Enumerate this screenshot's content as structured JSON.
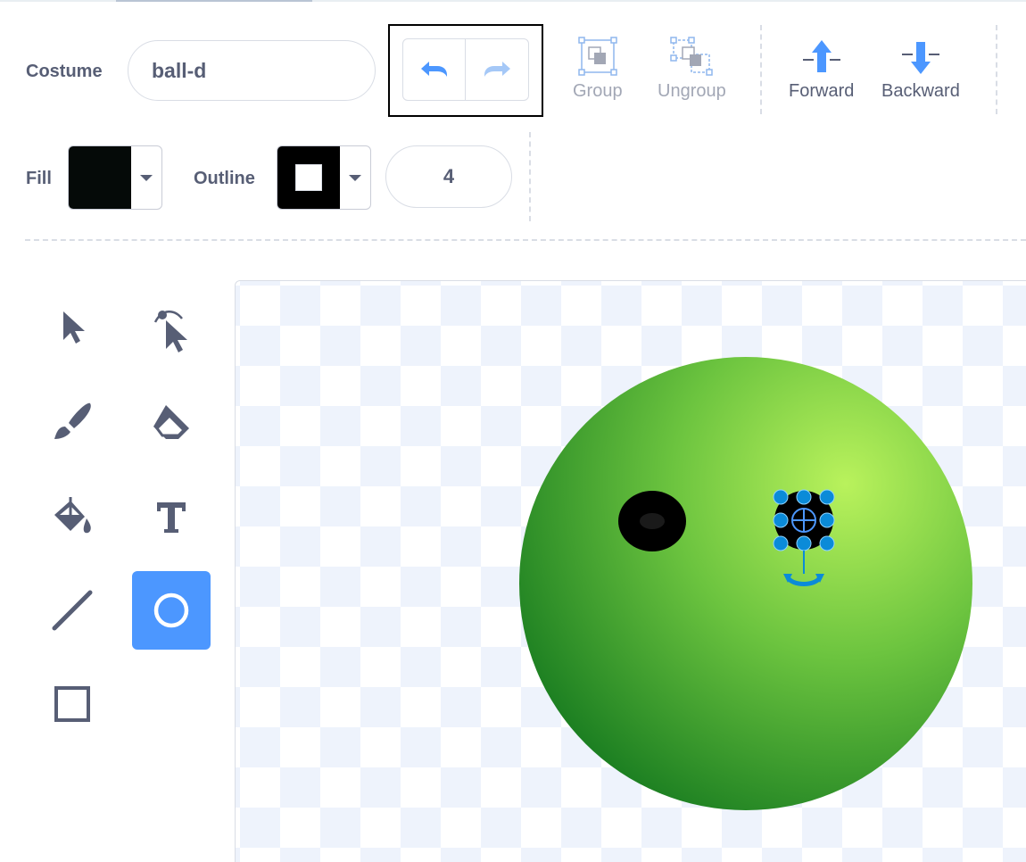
{
  "toolbar": {
    "costume_label": "Costume",
    "costume_name": "ball-d",
    "group_label": "Group",
    "ungroup_label": "Ungroup",
    "forward_label": "Forward",
    "backward_label": "Backward"
  },
  "style_bar": {
    "fill_label": "Fill",
    "outline_label": "Outline",
    "outline_width": "4",
    "fill_color": "#050a08",
    "outline_color": "#000000"
  },
  "tools": [
    {
      "name": "select-tool",
      "selected": false
    },
    {
      "name": "reshape-tool",
      "selected": false
    },
    {
      "name": "brush-tool",
      "selected": false
    },
    {
      "name": "eraser-tool",
      "selected": false
    },
    {
      "name": "fill-tool",
      "selected": false
    },
    {
      "name": "text-tool",
      "selected": false
    },
    {
      "name": "line-tool",
      "selected": false
    },
    {
      "name": "circle-tool",
      "selected": true
    },
    {
      "name": "rectangle-tool",
      "selected": false
    }
  ],
  "colors": {
    "accent": "#4c97ff",
    "text": "#575e75",
    "disabled_text": "#a2a7b5",
    "ball_light": "#b9f25c",
    "ball_dark": "#15791f"
  }
}
